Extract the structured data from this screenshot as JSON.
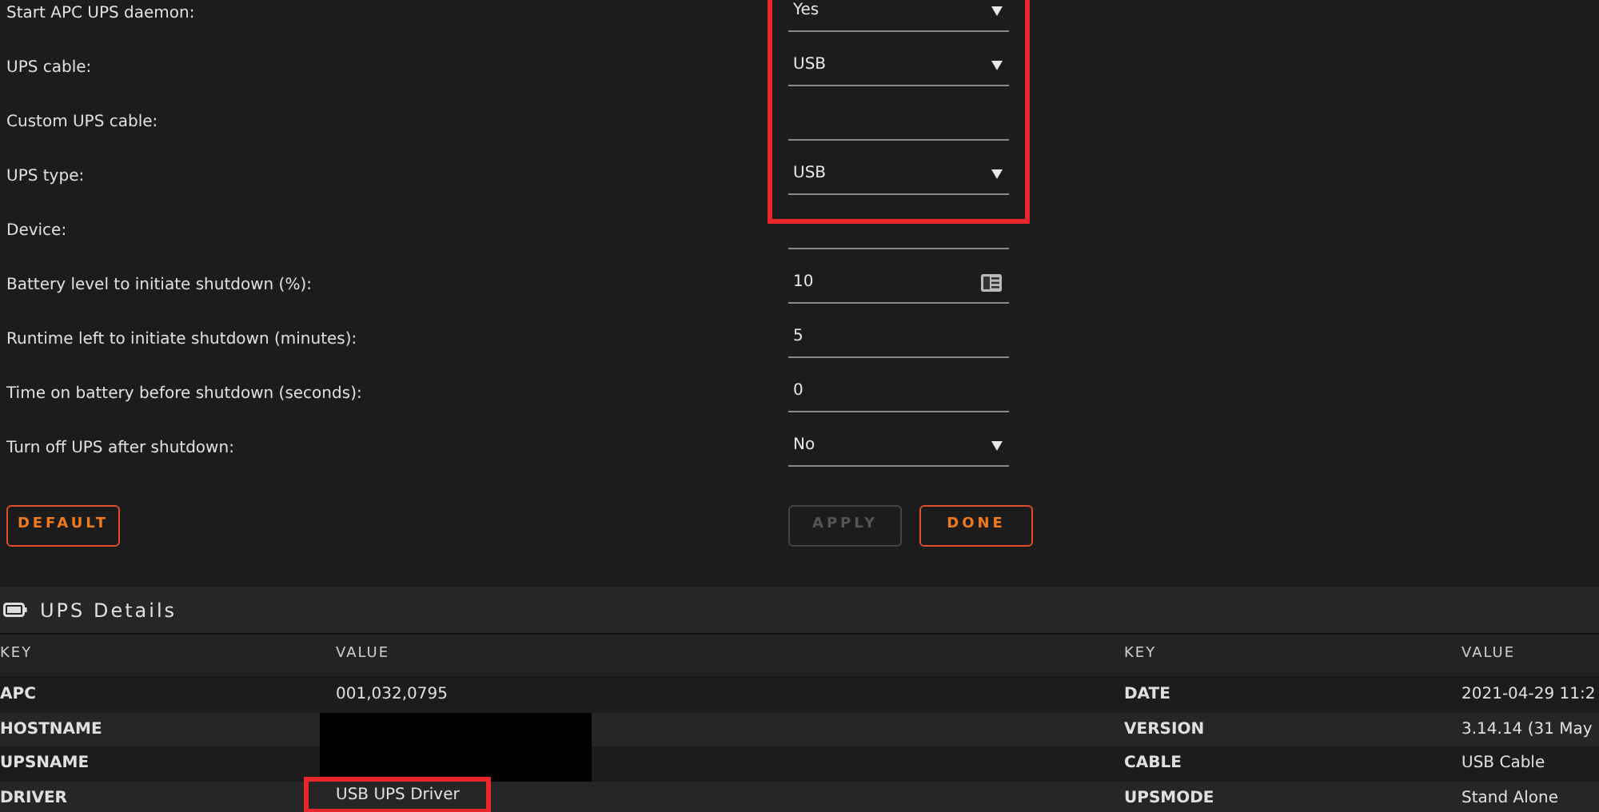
{
  "settings": [
    {
      "label": "Start APC UPS daemon:",
      "kind": "select",
      "value": "Yes",
      "highlighted": true
    },
    {
      "label": "UPS cable:",
      "kind": "select",
      "value": "USB",
      "highlighted": true
    },
    {
      "label": "Custom UPS cable:",
      "kind": "text",
      "highlighted": true
    },
    {
      "label": "UPS type:",
      "kind": "select",
      "value": "USB",
      "highlighted": true
    },
    {
      "label": "Device:",
      "kind": "text",
      "highlighted": false
    },
    {
      "label": "Battery level to initiate shutdown (%):",
      "kind": "number",
      "value": "10",
      "highlighted": false
    },
    {
      "label": "Runtime left to initiate shutdown (minutes):",
      "kind": "text",
      "value": "5",
      "highlighted": false
    },
    {
      "label": "Time on battery before shutdown (seconds):",
      "kind": "text",
      "value": "0",
      "highlighted": false
    },
    {
      "label": "Turn off UPS after shutdown:",
      "kind": "select",
      "value": "No",
      "highlighted": false
    }
  ],
  "buttons": {
    "default": {
      "label": "DEFAULT",
      "disabled": false
    },
    "apply": {
      "label": "APPLY",
      "disabled": true
    },
    "done": {
      "label": "DONE",
      "disabled": false
    }
  },
  "details": {
    "title": "UPS Details",
    "columns": [
      "KEY",
      "VALUE",
      "KEY",
      "VALUE"
    ],
    "rows": [
      {
        "key": "APC",
        "value": "001,032,0795",
        "redacted": false,
        "highlighted": false,
        "key2": "DATE",
        "value2": "2021-04-29 11:2"
      },
      {
        "key": "HOSTNAME",
        "redacted": true,
        "highlighted": false,
        "key2": "VERSION",
        "value2": "3.14.14 (31 May"
      },
      {
        "key": "UPSNAME",
        "redacted": true,
        "highlighted": false,
        "key2": "CABLE",
        "value2": "USB Cable"
      },
      {
        "key": "DRIVER",
        "value": "USB UPS Driver",
        "redacted": false,
        "highlighted": true,
        "key2": "UPSMODE",
        "value2": "Stand Alone"
      }
    ]
  }
}
